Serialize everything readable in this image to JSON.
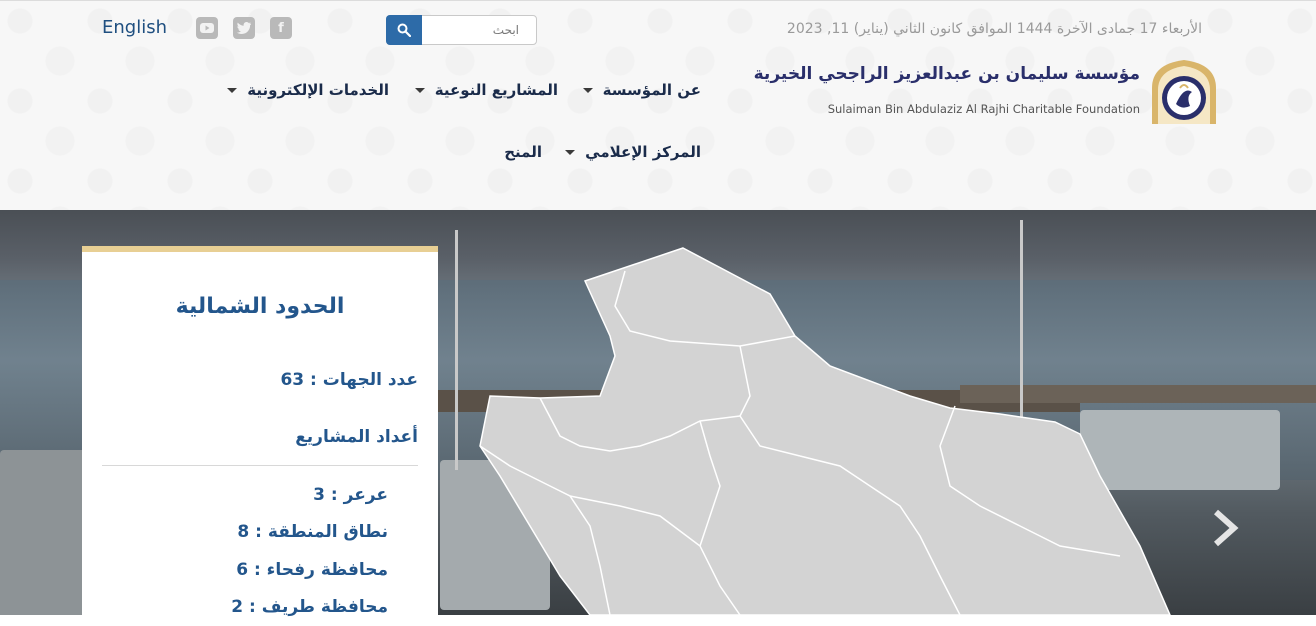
{
  "topbar": {
    "date": "الأربعاء 17 جمادى الآخرة 1444 الموافق كانون الثاني (يناير) 11, 2023",
    "search_placeholder": "ابحث",
    "language_link": "English",
    "social_icons": [
      "youtube-icon",
      "twitter-icon",
      "facebook-icon"
    ]
  },
  "logo": {
    "arabic_name": "مؤسسة سليمان بن عبدالعزيز الراجحي الخيرية",
    "english_name": "Sulaiman Bin Abdulaziz Al Rajhi Charitable Foundation"
  },
  "nav": {
    "items": [
      {
        "label": "عن المؤسسة",
        "dropdown": true
      },
      {
        "label": "المشاريع النوعية",
        "dropdown": true
      },
      {
        "label": "الخدمات الإلكترونية",
        "dropdown": true
      },
      {
        "label": "المركز الإعلامي",
        "dropdown": true
      },
      {
        "label": "المنح",
        "dropdown": false
      }
    ]
  },
  "panel": {
    "title": "الحدود الشمالية",
    "entities_count": "عدد الجهات : 63",
    "projects_heading": "أعداد المشاريع",
    "regions": [
      "عرعر : 3",
      "نطاق المنطقة : 8",
      "محافظة رفحاء : 6",
      "محافظة طريف : 2"
    ]
  },
  "colors": {
    "primary": "#23568c",
    "search_button": "#2d6ba8",
    "panel_accent": "#e8cf94",
    "map_fill": "#d3d3d3"
  }
}
